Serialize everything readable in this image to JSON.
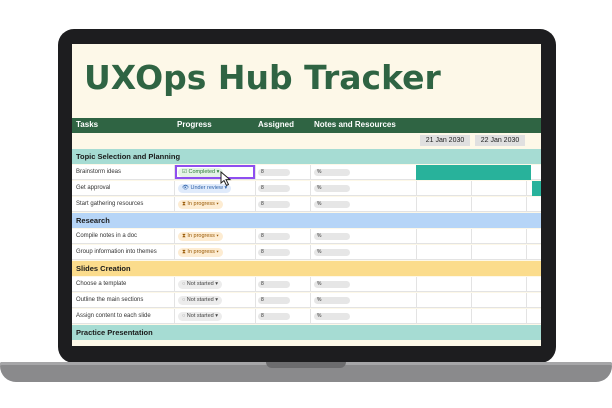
{
  "title": "UXOps Hub Tracker",
  "columns": {
    "tasks": "Tasks",
    "progress": "Progress",
    "assigned": "Assigned",
    "notes": "Notes and Resources"
  },
  "dates": [
    "21 Jan 2030",
    "22 Jan 2030"
  ],
  "groups": [
    {
      "name": "Topic Selection and Planning",
      "color": "#a6dcd3",
      "rows": [
        {
          "task": "Brainstorm ideas",
          "status": "Completed",
          "assigned": "8",
          "notes": "%"
        },
        {
          "task": "Get approval",
          "status": "Under review",
          "assigned": "8",
          "notes": "%"
        },
        {
          "task": "Start gathering resources",
          "status": "In progress",
          "assigned": "8",
          "notes": "%"
        }
      ]
    },
    {
      "name": "Research",
      "color": "#b6d5f7",
      "rows": [
        {
          "task": "Compile notes in a doc",
          "status": "In progress",
          "assigned": "8",
          "notes": "%"
        },
        {
          "task": "Group information into themes",
          "status": "In progress",
          "assigned": "8",
          "notes": "%"
        }
      ]
    },
    {
      "name": "Slides Creation",
      "color": "#fbdc8c",
      "rows": [
        {
          "task": "Choose a template",
          "status": "Not started",
          "assigned": "8",
          "notes": "%"
        },
        {
          "task": "Outline the main sections",
          "status": "Not started",
          "assigned": "8",
          "notes": "%"
        },
        {
          "task": "Assign content to each slide",
          "status": "Not started",
          "assigned": "8",
          "notes": "%"
        }
      ]
    },
    {
      "name": "Practice Presentation",
      "color": "#a6dcd3",
      "rows": []
    }
  ],
  "icons": {
    "done": "check-box-icon",
    "review": "eye-icon",
    "progress": "hourglass-icon",
    "not": "circle-icon",
    "caret": "chevron-down-icon"
  },
  "accent": "#2f6443",
  "gantt_color": "#28b29b"
}
